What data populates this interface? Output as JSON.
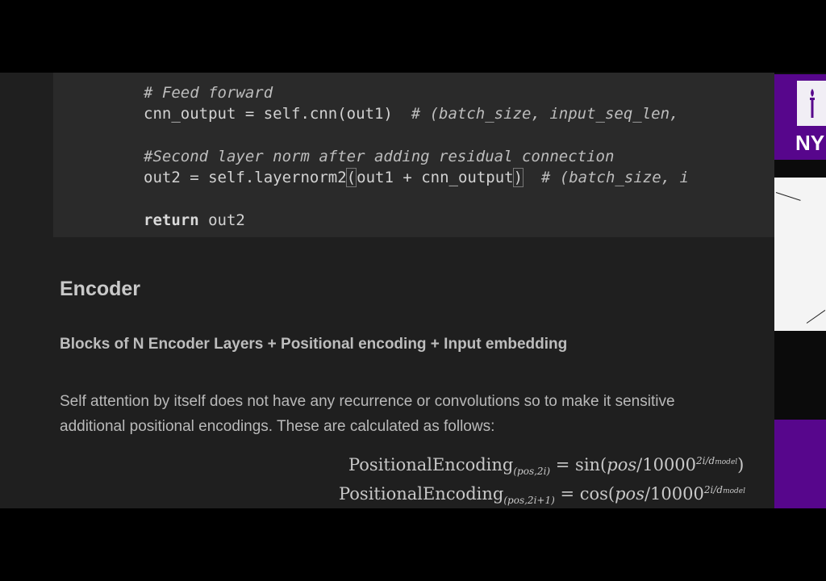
{
  "code": {
    "line1": "# Feed forward",
    "line2_code": "cnn_output = self.cnn(out1)  ",
    "line2_comment": "# (batch_size, input_seq_len,",
    "line3": "#Second layer norm after adding residual connection",
    "line4_a": "out2 = self.layernorm2",
    "line4_b": "(",
    "line4_c": "out1 + cnn_output",
    "line4_d": ")",
    "line4_comment": "  # (batch_size, i",
    "line5_kw": "return",
    "line5_rest": " out2"
  },
  "section": {
    "heading": "Encoder",
    "subheading": "Blocks of N Encoder Layers + Positional encoding + Input embedding",
    "para_line1": "Self attention by itself does not have any recurrence or convolutions so to make it sensitive",
    "para_line2": "additional positional encodings. These are calculated as follows:"
  },
  "formula": {
    "f1_name": "PositionalEncoding",
    "f1_sub": "(pos,2i)",
    "f1_eq": " = sin(",
    "f1_pos": "pos",
    "f1_div": "/10000",
    "f1_sup": "2i/d",
    "f1_sup_sub": "model",
    "f1_close": ")",
    "f2_name": "PositionalEncoding",
    "f2_sub": "(pos,2i+1)",
    "f2_eq": " = cos(",
    "f2_pos": "pos",
    "f2_div": "/10000",
    "f2_sup": "2i/d",
    "f2_sup_sub": "model"
  },
  "sidebar": {
    "logo_text": "NY",
    "logo_icon": "torch-icon"
  },
  "colors": {
    "brand_purple": "#57068c",
    "code_bg": "#2a2a2a",
    "page_bg": "#1f1f1f"
  }
}
